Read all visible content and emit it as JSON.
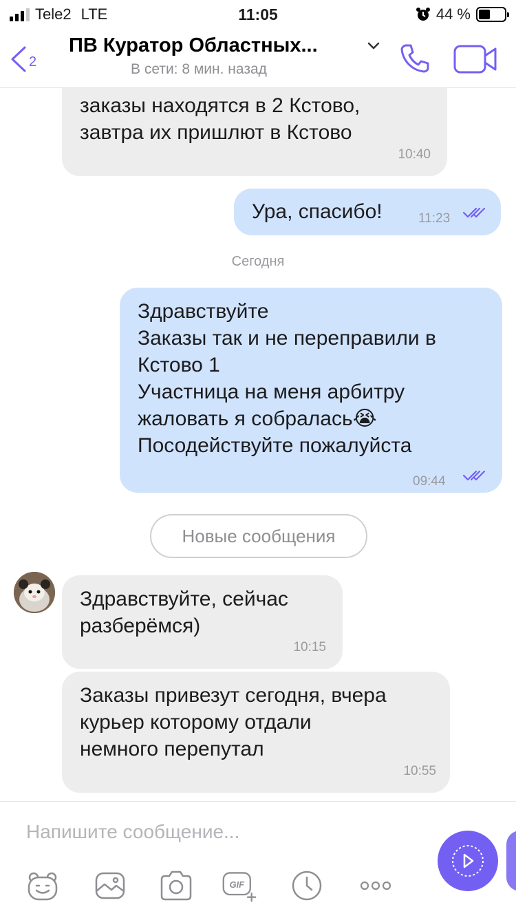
{
  "status_bar": {
    "carrier": "Tele2",
    "network": "LTE",
    "time": "11:05",
    "battery_text": "44 %",
    "battery_level": 0.44
  },
  "header": {
    "back_count": "2",
    "title": "ПВ Куратор Областных...",
    "subtitle": "В сети: 8 мин. назад",
    "icons": [
      "chevron-left-icon",
      "chevron-down-icon",
      "phone-icon",
      "video-camera-icon"
    ]
  },
  "chat": {
    "messages": [
      {
        "direction": "incoming",
        "text": "заказы находятся в 2 Кстово,\nзавтра их пришлют в Кстово",
        "time": "10:40"
      },
      {
        "direction": "outgoing",
        "text": "Ура, спасибо!",
        "time": "11:23",
        "status": "read"
      },
      {
        "direction": "outgoing",
        "text": "Здравствуйте\nЗаказы так и не переправили в\nКстово 1\nУчастница на меня  арбитру\nжаловать я собралась😭\nПосодействуйте пожалуйста",
        "time": "09:44",
        "status": "read"
      },
      {
        "direction": "incoming",
        "text": "Здравствуйте, сейчас\nразберёмся)",
        "time": "10:15"
      },
      {
        "direction": "incoming",
        "text": "Заказы привезут сегодня, вчера\nкурьер которому отдали\nнемного перепутал",
        "time": "10:55"
      }
    ],
    "date_separator": "Сегодня",
    "new_messages_label": "Новые сообщения"
  },
  "composer": {
    "placeholder": "Напишите сообщение...",
    "toolbar_icons": [
      "sticker-icon",
      "gallery-icon",
      "camera-icon",
      "gif-icon",
      "timer-icon",
      "more-icon"
    ],
    "gif_label": "GIF",
    "send_icon": "send-icon"
  },
  "colors": {
    "accent": "#7360f2",
    "incoming_bubble": "#ededed",
    "outgoing_bubble": "#d0e3fd",
    "meta_text": "#9a9aa0"
  }
}
